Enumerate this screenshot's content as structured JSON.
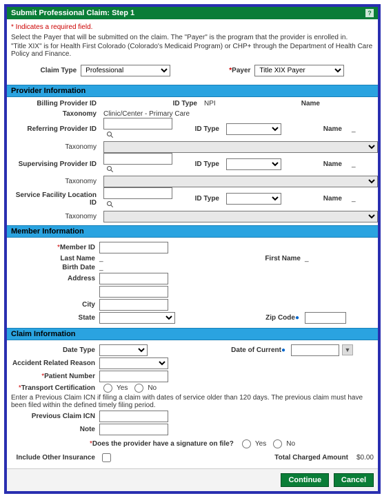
{
  "titlebar": {
    "title": "Submit Professional Claim: Step 1",
    "help_aria": "?"
  },
  "notes": {
    "required": "Indicates a required field.",
    "p1": "Select the Payer that will be submitted on the claim. The \"Payer\" is the program that the provider is enrolled in.",
    "p2": "\"Title XIX\" is for Health First Colorado (Colorado's Medicaid Program) or CHP+ through the Department of Health Care Policy and Finance."
  },
  "top": {
    "claim_type_label": "Claim Type",
    "claim_type_value": "Professional",
    "payer_label": "Payer",
    "payer_value": "Title XIX Payer"
  },
  "sections": {
    "provider": "Provider Information",
    "member": "Member Information",
    "claim": "Claim Information"
  },
  "provider": {
    "billing_id_label": "Billing Provider ID",
    "id_type_label": "ID Type",
    "id_type_value": "NPI",
    "name_label": "Name",
    "taxonomy_label": "Taxonomy",
    "taxonomy_value": "Clinic/Center - Primary Care",
    "referring_label": "Referring Provider ID",
    "supervising_label": "Supervising Provider ID",
    "service_facility_label": "Service Facility Location ID",
    "name_dash": "_"
  },
  "member": {
    "member_id_label": "Member ID",
    "last_name_label": "Last Name",
    "last_name_value": "_",
    "first_name_label": "First Name",
    "first_name_value": "_",
    "birth_date_label": "Birth Date",
    "birth_date_value": "_",
    "address_label": "Address",
    "city_label": "City",
    "state_label": "State",
    "zip_label": "Zip Code"
  },
  "claim": {
    "date_type_label": "Date Type",
    "date_of_current_label": "Date of Current",
    "accident_label": "Accident Related Reason",
    "patient_number_label": "Patient Number",
    "transport_cert_label": "Transport Certification",
    "yes": "Yes",
    "no": "No",
    "prev_note": "Enter a Previous Claim ICN if filing a claim with dates of service older than 120 days. The previous claim must have been filed within the defined timely filing period.",
    "prev_icn_label": "Previous Claim ICN",
    "note_label": "Note",
    "sig_question": "Does the provider have a signature on file?",
    "include_other_ins_label": "Include Other Insurance",
    "total_charged_label": "Total Charged Amount",
    "total_charged_value": "$0.00"
  },
  "buttons": {
    "continue": "Continue",
    "cancel": "Cancel"
  }
}
